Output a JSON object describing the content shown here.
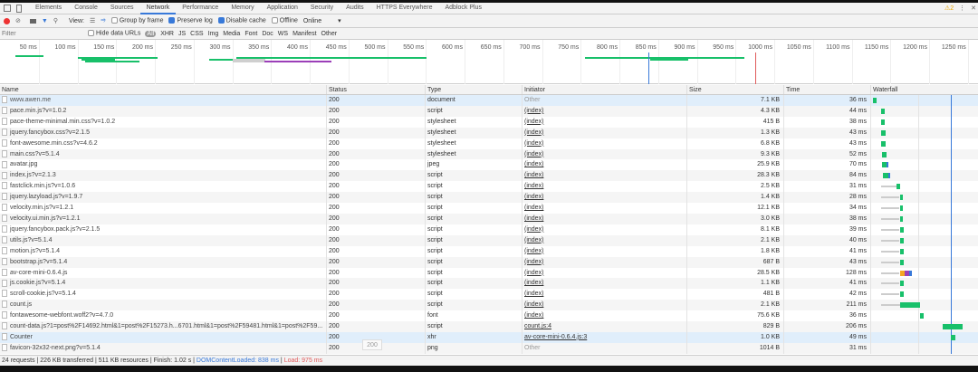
{
  "tabs": [
    "Elements",
    "Console",
    "Sources",
    "Network",
    "Performance",
    "Memory",
    "Application",
    "Security",
    "Audits",
    "HTTPS Everywhere",
    "Adblock Plus"
  ],
  "active_tab": "Network",
  "warnings": "2",
  "toolbar": {
    "view_label": "View:",
    "group_by_frame": "Group by frame",
    "preserve_log": "Preserve log",
    "disable_cache": "Disable cache",
    "offline": "Offline",
    "throttle": "Online"
  },
  "filter": {
    "placeholder": "Filter",
    "hide_data_urls": "Hide data URLs",
    "types": [
      "All",
      "XHR",
      "JS",
      "CSS",
      "Img",
      "Media",
      "Font",
      "Doc",
      "WS",
      "Manifest",
      "Other"
    ]
  },
  "overview": {
    "ticks": [
      "50 ms",
      "100 ms",
      "150 ms",
      "200 ms",
      "250 ms",
      "300 ms",
      "350 ms",
      "400 ms",
      "450 ms",
      "500 ms",
      "550 ms",
      "600 ms",
      "650 ms",
      "700 ms",
      "750 ms",
      "800 ms",
      "850 ms",
      "900 ms",
      "950 ms",
      "1000 ms",
      "1050 ms",
      "1100 ms",
      "1150 ms",
      "1200 ms",
      "1250 ms"
    ],
    "dom_content_loaded_ms": 838,
    "load_ms": 975
  },
  "columns": [
    "Name",
    "Status",
    "Type",
    "Initiator",
    "Size",
    "Time",
    "Waterfall"
  ],
  "colors": {
    "green": "#18c06a",
    "blue": "#3879d9",
    "red": "#e05a5a",
    "orange": "#f5a623",
    "purple": "#9b3fb8"
  },
  "rows": [
    {
      "name": "www.awen.me",
      "status": "200",
      "type": "document",
      "initiator": "Other",
      "size": "7.1 KB",
      "time": "36 ms",
      "start": 20,
      "dur": 36,
      "queue": 0
    },
    {
      "name": "pace.min.js?v=1.0.2",
      "status": "200",
      "type": "script",
      "initiator": "(index)",
      "size": "4.3 KB",
      "time": "44 ms",
      "start": 100,
      "dur": 44,
      "queue": 0
    },
    {
      "name": "pace-theme-minimal.min.css?v=1.0.2",
      "status": "200",
      "type": "stylesheet",
      "initiator": "(index)",
      "size": "415 B",
      "time": "38 ms",
      "start": 105,
      "dur": 38,
      "queue": 0
    },
    {
      "name": "jquery.fancybox.css?v=2.1.5",
      "status": "200",
      "type": "stylesheet",
      "initiator": "(index)",
      "size": "1.3 KB",
      "time": "43 ms",
      "start": 105,
      "dur": 43,
      "queue": 0
    },
    {
      "name": "font-awesome.min.css?v=4.6.2",
      "status": "200",
      "type": "stylesheet",
      "initiator": "(index)",
      "size": "6.8 KB",
      "time": "43 ms",
      "start": 105,
      "dur": 43,
      "queue": 0
    },
    {
      "name": "main.css?v=5.1.4",
      "status": "200",
      "type": "stylesheet",
      "initiator": "(index)",
      "size": "9.3 KB",
      "time": "52 ms",
      "start": 110,
      "dur": 52,
      "queue": 0
    },
    {
      "name": "avatar.jpg",
      "status": "200",
      "type": "jpeg",
      "initiator": "(index)",
      "size": "25.9 KB",
      "time": "70 ms",
      "start": 110,
      "dur": 70,
      "queue": 0
    },
    {
      "name": "index.js?v=2.1.3",
      "status": "200",
      "type": "script",
      "initiator": "(index)",
      "size": "28.3 KB",
      "time": "84 ms",
      "start": 120,
      "dur": 84,
      "queue": 0
    },
    {
      "name": "fastclick.min.js?v=1.0.6",
      "status": "200",
      "type": "script",
      "initiator": "(index)",
      "size": "2.5 KB",
      "time": "31 ms",
      "start": 270,
      "dur": 31,
      "queue": 105
    },
    {
      "name": "jquery.lazyload.js?v=1.9.7",
      "status": "200",
      "type": "script",
      "initiator": "(index)",
      "size": "1.4 KB",
      "time": "28 ms",
      "start": 300,
      "dur": 28,
      "queue": 105
    },
    {
      "name": "velocity.min.js?v=1.2.1",
      "status": "200",
      "type": "script",
      "initiator": "(index)",
      "size": "12.1 KB",
      "time": "34 ms",
      "start": 300,
      "dur": 34,
      "queue": 105
    },
    {
      "name": "velocity.ui.min.js?v=1.2.1",
      "status": "200",
      "type": "script",
      "initiator": "(index)",
      "size": "3.0 KB",
      "time": "38 ms",
      "start": 300,
      "dur": 38,
      "queue": 105
    },
    {
      "name": "jquery.fancybox.pack.js?v=2.1.5",
      "status": "200",
      "type": "script",
      "initiator": "(index)",
      "size": "8.1 KB",
      "time": "39 ms",
      "start": 300,
      "dur": 39,
      "queue": 105
    },
    {
      "name": "utils.js?v=5.1.4",
      "status": "200",
      "type": "script",
      "initiator": "(index)",
      "size": "2.1 KB",
      "time": "40 ms",
      "start": 300,
      "dur": 40,
      "queue": 105
    },
    {
      "name": "motion.js?v=5.1.4",
      "status": "200",
      "type": "script",
      "initiator": "(index)",
      "size": "1.8 KB",
      "time": "41 ms",
      "start": 300,
      "dur": 41,
      "queue": 105
    },
    {
      "name": "bootstrap.js?v=5.1.4",
      "status": "200",
      "type": "script",
      "initiator": "(index)",
      "size": "687 B",
      "time": "43 ms",
      "start": 300,
      "dur": 43,
      "queue": 105
    },
    {
      "name": "av-core-mini-0.6.4.js",
      "status": "200",
      "type": "script",
      "initiator": "(index)",
      "size": "28.5 KB",
      "time": "128 ms",
      "start": 300,
      "dur": 128,
      "queue": 105,
      "multi": true
    },
    {
      "name": "js.cookie.js?v=5.1.4",
      "status": "200",
      "type": "script",
      "initiator": "(index)",
      "size": "1.1 KB",
      "time": "41 ms",
      "start": 300,
      "dur": 41,
      "queue": 105
    },
    {
      "name": "scroll-cookie.js?v=5.1.4",
      "status": "200",
      "type": "script",
      "initiator": "(index)",
      "size": "481 B",
      "time": "42 ms",
      "start": 300,
      "dur": 42,
      "queue": 105
    },
    {
      "name": "count.js",
      "status": "200",
      "type": "script",
      "initiator": "(index)",
      "size": "2.1 KB",
      "time": "211 ms",
      "start": 305,
      "dur": 211,
      "queue": 105
    },
    {
      "name": "fontawesome-webfont.woff2?v=4.7.0",
      "status": "200",
      "type": "font",
      "initiator": "(index)",
      "size": "75.6 KB",
      "time": "36 ms",
      "start": 515,
      "dur": 36,
      "queue": 0
    },
    {
      "name": "count-data.js?1=post%2F14692.html&1=post%2F15273.h...6701.html&1=post%2F59481.html&1=post%2F59...",
      "status": "200",
      "type": "script",
      "initiator": "count.js:4",
      "size": "829 B",
      "time": "206 ms",
      "start": 755,
      "dur": 206,
      "queue": 0
    },
    {
      "name": "Counter",
      "status": "200",
      "type": "xhr",
      "initiator": "av-core-mini-0.6.4.js:3",
      "size": "1.0 KB",
      "time": "49 ms",
      "start": 840,
      "dur": 49,
      "queue": 0
    },
    {
      "name": "favicon-32x32-next.png?v=5.1.4",
      "status": "200",
      "type": "png",
      "initiator": "Other",
      "size": "1014 B",
      "time": "31 ms",
      "start": 1200,
      "dur": 31,
      "queue": 0
    }
  ],
  "tooltip": "200",
  "footer": {
    "summary": "24 requests | 226 KB transferred | 511 KB resources | Finish: 1.02 s | ",
    "dcl": "DOMContentLoaded: 838 ms",
    "sep": " | ",
    "load": "Load: 975 ms"
  }
}
